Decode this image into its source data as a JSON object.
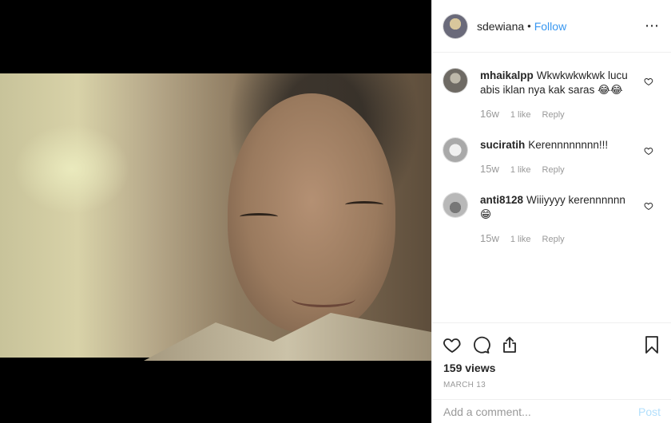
{
  "header": {
    "username": "sdewiana",
    "separator": "•",
    "follow_label": "Follow",
    "more_icon": "⋯"
  },
  "comments": [
    {
      "user": "mhaikalpp",
      "text": "Wkwkwkwkwk lucu abis iklan nya kak saras 😂😂",
      "time": "16w",
      "likes": "1 like",
      "reply": "Reply"
    },
    {
      "user": "suciratih",
      "text": "Kerennnnnnnn!!!",
      "time": "15w",
      "likes": "1 like",
      "reply": "Reply"
    },
    {
      "user": "anti8128",
      "text": "Wiiiyyyy kerennnnnn😁",
      "time": "15w",
      "likes": "1 like",
      "reply": "Reply"
    }
  ],
  "actions": {
    "views": "159 views",
    "date": "MARCH 13"
  },
  "composer": {
    "placeholder": "Add a comment...",
    "post_label": "Post"
  },
  "colors": {
    "accent": "#3897f0",
    "post_disabled": "#b2dffc",
    "muted": "#999999"
  },
  "icons": [
    "heart-icon",
    "comment-icon",
    "share-icon",
    "bookmark-icon",
    "more-options-icon"
  ]
}
